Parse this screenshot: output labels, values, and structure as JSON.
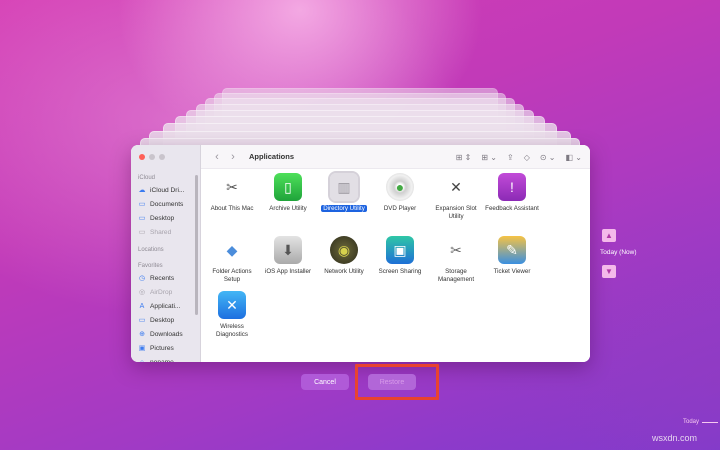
{
  "finder": {
    "title": "Applications",
    "nav_back": "‹",
    "nav_forward": "›",
    "toolbar_icons": [
      "grid-view-icon",
      "group-icon",
      "share-icon",
      "tag-icon",
      "more-icon",
      "appearance-icon"
    ],
    "sidebar": {
      "sections": {
        "icloud": "iCloud",
        "locations": "Locations",
        "favorites": "Favorites"
      },
      "icloud_items": [
        {
          "label": "iCloud Dri...",
          "icon": "cloud-icon"
        },
        {
          "label": "Documents",
          "icon": "document-icon"
        },
        {
          "label": "Desktop",
          "icon": "desktop-icon"
        },
        {
          "label": "Shared",
          "icon": "shared-folder-icon"
        }
      ],
      "favorites_items": [
        {
          "label": "Recents",
          "icon": "clock-icon"
        },
        {
          "label": "AirDrop",
          "icon": "airdrop-icon"
        },
        {
          "label": "Applicati...",
          "icon": "applications-icon"
        },
        {
          "label": "Desktop",
          "icon": "desktop-icon"
        },
        {
          "label": "Downloads",
          "icon": "downloads-icon"
        },
        {
          "label": "Pictures",
          "icon": "pictures-icon"
        },
        {
          "label": "noname",
          "icon": "home-icon"
        }
      ]
    },
    "apps": [
      {
        "label": "About This Mac",
        "icon": "about-this-mac-icon"
      },
      {
        "label": "Archive Utility",
        "icon": "archive-utility-icon"
      },
      {
        "label": "Directory Utility",
        "icon": "directory-utility-icon",
        "selected": true
      },
      {
        "label": "DVD Player",
        "icon": "dvd-player-icon"
      },
      {
        "label": "Expansion Slot Utility",
        "icon": "expansion-slot-utility-icon"
      },
      {
        "label": "Feedback Assistant",
        "icon": "feedback-assistant-icon"
      },
      {
        "label": "Folder Actions Setup",
        "icon": "folder-actions-setup-icon"
      },
      {
        "label": "iOS App Installer",
        "icon": "ios-app-installer-icon"
      },
      {
        "label": "Network Utility",
        "icon": "network-utility-icon"
      },
      {
        "label": "Screen Sharing",
        "icon": "screen-sharing-icon"
      },
      {
        "label": "Storage Management",
        "icon": "storage-management-icon"
      },
      {
        "label": "Ticket Viewer",
        "icon": "ticket-viewer-icon"
      },
      {
        "label": "Wireless Diagnostics",
        "icon": "wireless-diagnostics-icon"
      }
    ]
  },
  "buttons": {
    "cancel": "Cancel",
    "restore": "Restore"
  },
  "timeline": {
    "current": "Today (Now)",
    "today": "Today"
  },
  "watermark": "wsxdn.com"
}
